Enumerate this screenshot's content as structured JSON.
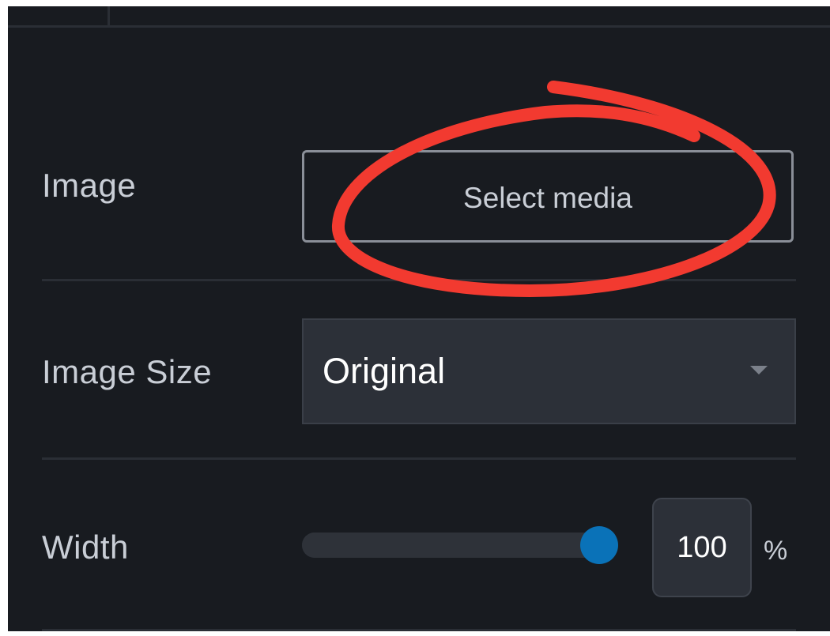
{
  "image": {
    "label": "Image",
    "button_label": "Select media"
  },
  "image_size": {
    "label": "Image Size",
    "selected": "Original"
  },
  "width": {
    "label": "Width",
    "value": "100",
    "unit": "%",
    "slider_percent": 100
  },
  "colors": {
    "panel_background": "#181b20",
    "slider_thumb": "#0a72b8",
    "annotation": "#f23a30"
  },
  "icons": {
    "dropdown": "caret-down-icon",
    "annotation": "circle-annotation-icon"
  }
}
